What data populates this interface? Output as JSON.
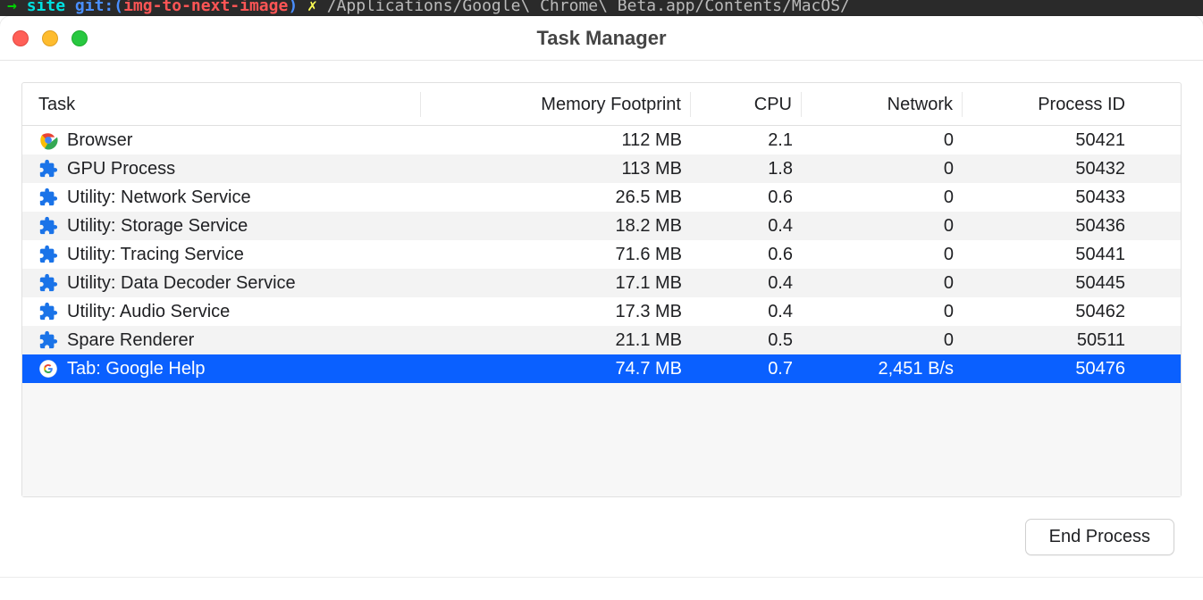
{
  "terminal_fragment": {
    "arrow": "→",
    "project": "site",
    "git_label": "git:(",
    "branch": "img-to-next-image",
    "git_close": ")",
    "star": "✗",
    "path": "/Applications/Google\\ Chrome\\ Beta.app/Contents/MacOS/"
  },
  "window": {
    "title": "Task Manager"
  },
  "columns": {
    "task": "Task",
    "memory": "Memory Footprint",
    "cpu": "CPU",
    "network": "Network",
    "pid": "Process ID"
  },
  "rows": [
    {
      "icon": "chrome",
      "task": "Browser",
      "memory": "112 MB",
      "cpu": "2.1",
      "network": "0",
      "pid": "50421",
      "selected": false
    },
    {
      "icon": "puzzle",
      "task": "GPU Process",
      "memory": "113 MB",
      "cpu": "1.8",
      "network": "0",
      "pid": "50432",
      "selected": false
    },
    {
      "icon": "puzzle",
      "task": "Utility: Network Service",
      "memory": "26.5 MB",
      "cpu": "0.6",
      "network": "0",
      "pid": "50433",
      "selected": false
    },
    {
      "icon": "puzzle",
      "task": "Utility: Storage Service",
      "memory": "18.2 MB",
      "cpu": "0.4",
      "network": "0",
      "pid": "50436",
      "selected": false
    },
    {
      "icon": "puzzle",
      "task": "Utility: Tracing Service",
      "memory": "71.6 MB",
      "cpu": "0.6",
      "network": "0",
      "pid": "50441",
      "selected": false
    },
    {
      "icon": "puzzle",
      "task": "Utility: Data Decoder Service",
      "memory": "17.1 MB",
      "cpu": "0.4",
      "network": "0",
      "pid": "50445",
      "selected": false
    },
    {
      "icon": "puzzle",
      "task": "Utility: Audio Service",
      "memory": "17.3 MB",
      "cpu": "0.4",
      "network": "0",
      "pid": "50462",
      "selected": false
    },
    {
      "icon": "puzzle",
      "task": "Spare Renderer",
      "memory": "21.1 MB",
      "cpu": "0.5",
      "network": "0",
      "pid": "50511",
      "selected": false
    },
    {
      "icon": "google",
      "task": "Tab: Google Help",
      "memory": "74.7 MB",
      "cpu": "0.7",
      "network": "2,451 B/s",
      "pid": "50476",
      "selected": true
    }
  ],
  "footer": {
    "end_process": "End Process"
  }
}
